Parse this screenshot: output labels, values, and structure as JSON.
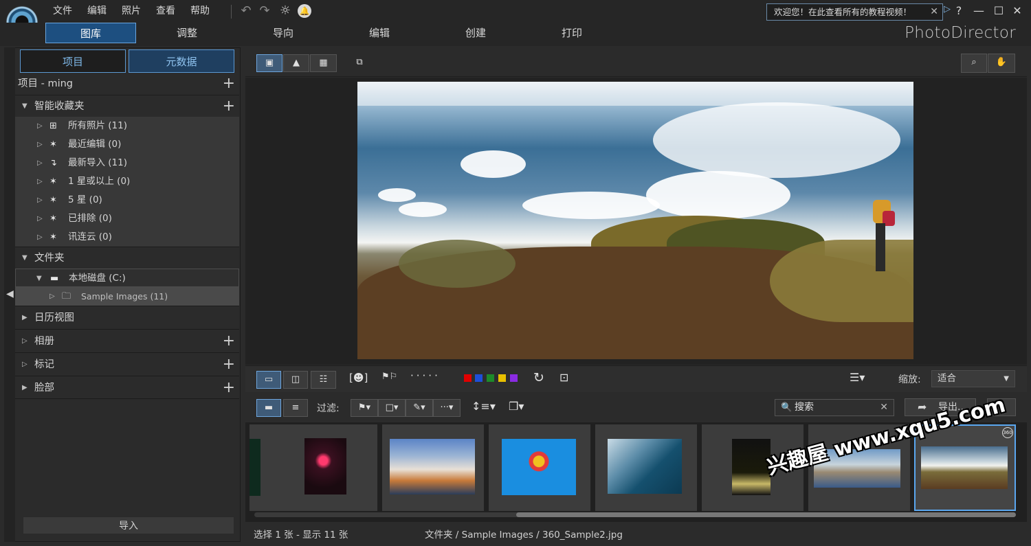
{
  "menu": [
    "文件",
    "编辑",
    "照片",
    "查看",
    "帮助"
  ],
  "notice": {
    "text": "欢迎您！在此查看所有的教程视频！"
  },
  "modules": [
    "图库",
    "调整",
    "导向",
    "编辑",
    "创建",
    "打印"
  ],
  "brand": "PhotoDirector",
  "panel_tabs": [
    "项目",
    "元数据"
  ],
  "project": {
    "label": "项目 - ming"
  },
  "smart_collections": {
    "label": "智能收藏夹",
    "items": [
      "所有照片 (11)",
      "最近编辑 (0)",
      "最新导入 (11)",
      "1 星或以上 (0)",
      "5 星 (0)",
      "已排除 (0)",
      "讯连云 (0)"
    ]
  },
  "folders": {
    "label": "文件夹",
    "disk": "本地磁盘 (C:)",
    "folder": "Sample Images (11)"
  },
  "sections": [
    "日历视图",
    "相册",
    "标记",
    "脸部"
  ],
  "import_label": "导入",
  "zoom": {
    "label": "缩放:",
    "value": "适合"
  },
  "filter_label": "过滤:",
  "search": {
    "placeholder": "搜索"
  },
  "export_label": "导出...",
  "status": {
    "selection": "选择 1 张 - 显示 11 张",
    "path": "文件夹 / Sample Images / 360_Sample2.jpg"
  },
  "badge": "360",
  "colors": {
    "accent": "#1d4f80",
    "highlight": "#5aa7f0",
    "labels": [
      "#e00000",
      "#1e4fd8",
      "#1d8a2a",
      "#e8c000",
      "#8a2be2"
    ]
  },
  "watermark": "兴趣屋 www.xqu5.com"
}
